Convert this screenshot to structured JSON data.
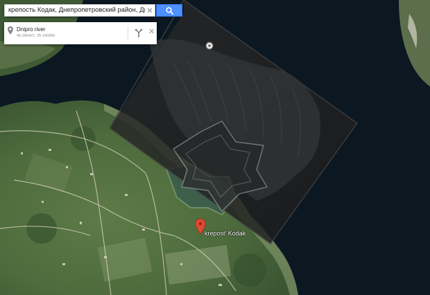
{
  "search": {
    "value": "крепость Кодак, Днепропетровский район, Днiпропе"
  },
  "place_card": {
    "title": "Dnipro river",
    "coords": "48.390407, 35.140340"
  },
  "map_label": "krepost' Kodak",
  "icons": [
    "close-icon",
    "search-icon",
    "location-pin-icon",
    "directions-icon",
    "close-icon",
    "map-marker-icon",
    "poi-icon"
  ],
  "colors": {
    "search_button": "#4d90fe",
    "marker": "#dd4b39",
    "water": "#0b1721"
  }
}
